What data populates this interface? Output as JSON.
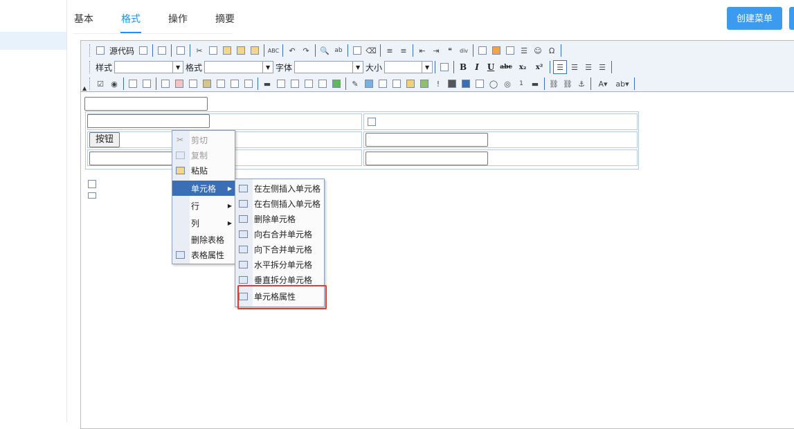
{
  "tabs": [
    {
      "label": "基本",
      "active": false
    },
    {
      "label": "格式",
      "active": true
    },
    {
      "label": "操作",
      "active": false
    },
    {
      "label": "摘要",
      "active": false
    }
  ],
  "header": {
    "create_menu_label": "创建菜单"
  },
  "toolbar": {
    "source_label": "源代码",
    "style_label": "样式",
    "format_label": "格式",
    "font_label": "字体",
    "size_label": "大小",
    "bold": "B",
    "italic": "I",
    "underline": "U",
    "strike": "abc",
    "subscript": "x₂",
    "superscript": "x²",
    "omega": "Ω"
  },
  "content": {
    "button_label": "按钮"
  },
  "context_menu": {
    "items": [
      {
        "label": "剪切",
        "disabled": true,
        "icon": "cut-icon"
      },
      {
        "label": "复制",
        "disabled": true,
        "icon": "copy-icon"
      },
      {
        "label": "粘贴",
        "disabled": false,
        "icon": "paste-icon"
      },
      {
        "label": "单元格",
        "submenu": true,
        "active": true
      },
      {
        "label": "行",
        "submenu": true
      },
      {
        "label": "列",
        "submenu": true
      },
      {
        "label": "删除表格"
      },
      {
        "label": "表格属性",
        "icon": "table-icon"
      }
    ]
  },
  "cell_submenu": {
    "items": [
      {
        "label": "在左侧插入单元格",
        "icon": "insert-cell-left-icon"
      },
      {
        "label": "在右侧插入单元格",
        "icon": "insert-cell-right-icon"
      },
      {
        "label": "删除单元格",
        "icon": "delete-cell-icon"
      },
      {
        "label": "向右合并单元格",
        "icon": "merge-right-icon"
      },
      {
        "label": "向下合并单元格",
        "icon": "merge-down-icon"
      },
      {
        "label": "水平拆分单元格",
        "icon": "split-horizontal-icon"
      },
      {
        "label": "垂直拆分单元格",
        "icon": "split-vertical-icon"
      },
      {
        "label": "单元格属性",
        "icon": "cell-properties-icon",
        "highlighted": true
      }
    ]
  },
  "colors": {
    "accent": "#1890ff",
    "button": "#3d9bef",
    "highlight": "#e23a2e",
    "menu_hover": "#3b6eb4"
  }
}
